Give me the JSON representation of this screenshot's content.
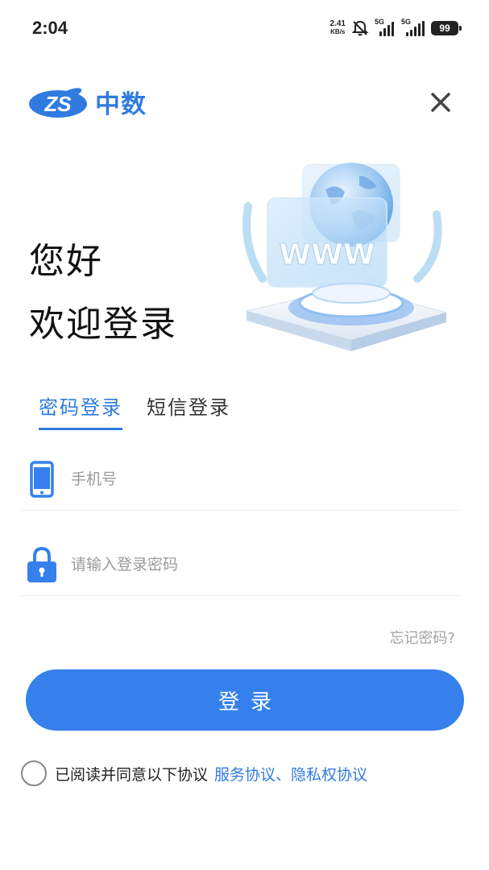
{
  "status_bar": {
    "time": "2:04",
    "net_speed_value": "2.41",
    "net_speed_unit": "KB/s",
    "sim1_label": "5G",
    "sim2_label": "5G",
    "battery": "99"
  },
  "header": {
    "logo_badge": "ZS",
    "logo_text": "中数",
    "close_icon": "close-icon",
    "brand_color": "#2f7be0"
  },
  "greeting": {
    "line1": "您好",
    "line2": "欢迎登录"
  },
  "hero": {
    "sign_text": "WWW"
  },
  "tabs": [
    {
      "label": "密码登录",
      "active": true
    },
    {
      "label": "短信登录",
      "active": false
    }
  ],
  "form": {
    "phone_placeholder": "手机号",
    "password_placeholder": "请输入登录密码",
    "phone_icon": "phone-icon",
    "lock_icon": "lock-icon"
  },
  "forgot_label": "忘记密码?",
  "login_button_label": "登录",
  "agreement": {
    "text": "已阅读并同意以下协议",
    "link1": "服务协议",
    "separator": "、",
    "link2": "隐私权协议"
  }
}
